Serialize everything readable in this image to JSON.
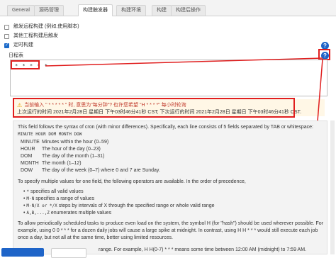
{
  "tabs": [
    "General",
    "源码管理",
    "构建触发器",
    "构建环境",
    "构建",
    "构建后操作"
  ],
  "triggers": [
    {
      "label": "触发远程构建 (例如,使用脚本)",
      "checked": false
    },
    {
      "label": "其他工程构建后触发",
      "checked": false
    },
    {
      "label": "定时构建",
      "checked": true
    }
  ],
  "schedule": {
    "label": "日程表",
    "value": "* * * * *"
  },
  "warning": {
    "icon": "warning-icon",
    "line1": "当前输入 \" * * * * * \" 时, 意思为\"每分钟\"? 也许您希望 \"H * * * *\" 每小时轮询",
    "line2": "上次运行的时间 2021年2月28日 星期日 下午03时46分41秒 CST; 下次运行的时间 2021年2月28日 星期日 下午03时46分41秒 CST."
  },
  "help": {
    "intro1": "This field follows the syntax of cron (with minor differences). Specifically, each line consists of 5 fields separated by TAB or whitespace:",
    "intro2": "MINUTE HOUR DOM MONTH DOW",
    "fields": [
      {
        "name": "MINUTE",
        "desc": "Minutes within the hour (0–59)"
      },
      {
        "name": "HOUR",
        "desc": "The hour of the day (0–23)"
      },
      {
        "name": "DOM",
        "desc": "The day of the month (1–31)"
      },
      {
        "name": "MONTH",
        "desc": "The month (1–12)"
      },
      {
        "name": "DOW",
        "desc": "The day of the week (0–7) where 0 and 7 are Sunday."
      }
    ],
    "operators_intro": "To specify multiple values for one field, the following operators are available. In the order of precedence,",
    "operators": [
      {
        "op": "*",
        "desc": " specifies all valid values"
      },
      {
        "op": "M-N",
        "desc": " specifies a range of values"
      },
      {
        "op": "M-N/X or */X",
        "desc": " steps by intervals of X through the specified range or whole valid range"
      },
      {
        "op": "A,B,...,Z",
        "desc": " enumerates multiple values"
      }
    ],
    "para1": "To allow periodically scheduled tasks to produce even load on the system, the symbol H (for \"hash\") should be used wherever possible. For",
    "para2": "example, using 0 0 * * * for a dozen daily jobs will cause a large spike at midnight. In contrast, using H H * * * would still execute each job",
    "para3": "once a day, but not all at the same time, better using limited resources.",
    "para4": "range. For example, H H(0-7) * * * means some time between 12:00 AM (midnight) to 7:59 AM."
  },
  "help_icons": {
    "trigger": "?",
    "schedule": "?"
  },
  "colors": {
    "accent": "#1e64c8",
    "highlight": "#e01e1e",
    "warning_bg": "#fff7e6"
  }
}
